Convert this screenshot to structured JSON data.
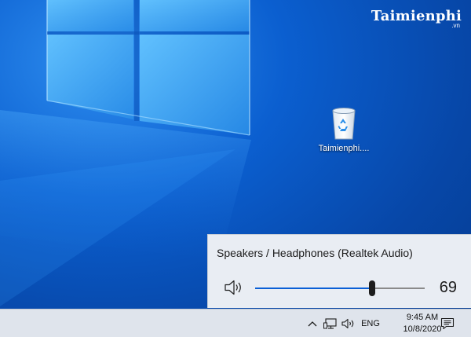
{
  "watermark": {
    "brand": "Taimienphi",
    "tld": ".vn"
  },
  "desktop": {
    "icons": [
      {
        "label": "Taimienphi....",
        "icon": "recycle-bin-icon"
      }
    ]
  },
  "volume_flyout": {
    "device_name": "Speakers / Headphones (Realtek Audio)",
    "speaker_icon": "speaker-icon",
    "volume": 69,
    "volume_display": "69",
    "accent_color": "#0a5fd6"
  },
  "taskbar": {
    "tray": {
      "chevron_icon": "chevron-up-icon",
      "network_icon": "network-icon",
      "volume_icon": "volume-icon",
      "language": "ENG",
      "time": "9:45 AM",
      "date": "10/8/2020",
      "notification_icon": "notification-icon"
    }
  }
}
